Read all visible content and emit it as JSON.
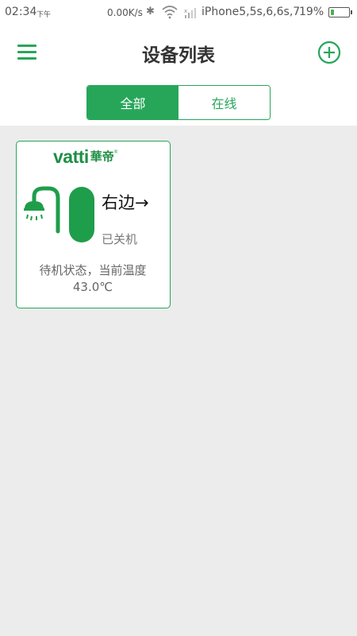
{
  "status_bar": {
    "time": "02:34",
    "ampm": "下午",
    "network_speed": "0.00K/s",
    "carrier": "iPhone5,5s,6,6s,7",
    "battery_percent": "19%",
    "battery_level": 0.19
  },
  "header": {
    "title": "设备列表",
    "menu_icon": "hamburger-menu-icon",
    "add_icon": "plus-circle-icon"
  },
  "tabs": [
    {
      "label": "全部",
      "active": true
    },
    {
      "label": "在线",
      "active": false
    }
  ],
  "devices": [
    {
      "brand_en": "vatti",
      "brand_cn": "華帝",
      "icon": "water-heater-shower-icon",
      "name": "右边→",
      "power_state": "已关机",
      "status_line1": "待机状态，当前温度",
      "status_line2": "43.0℃"
    }
  ],
  "colors": {
    "accent": "#27a65a",
    "background": "#ececec"
  }
}
